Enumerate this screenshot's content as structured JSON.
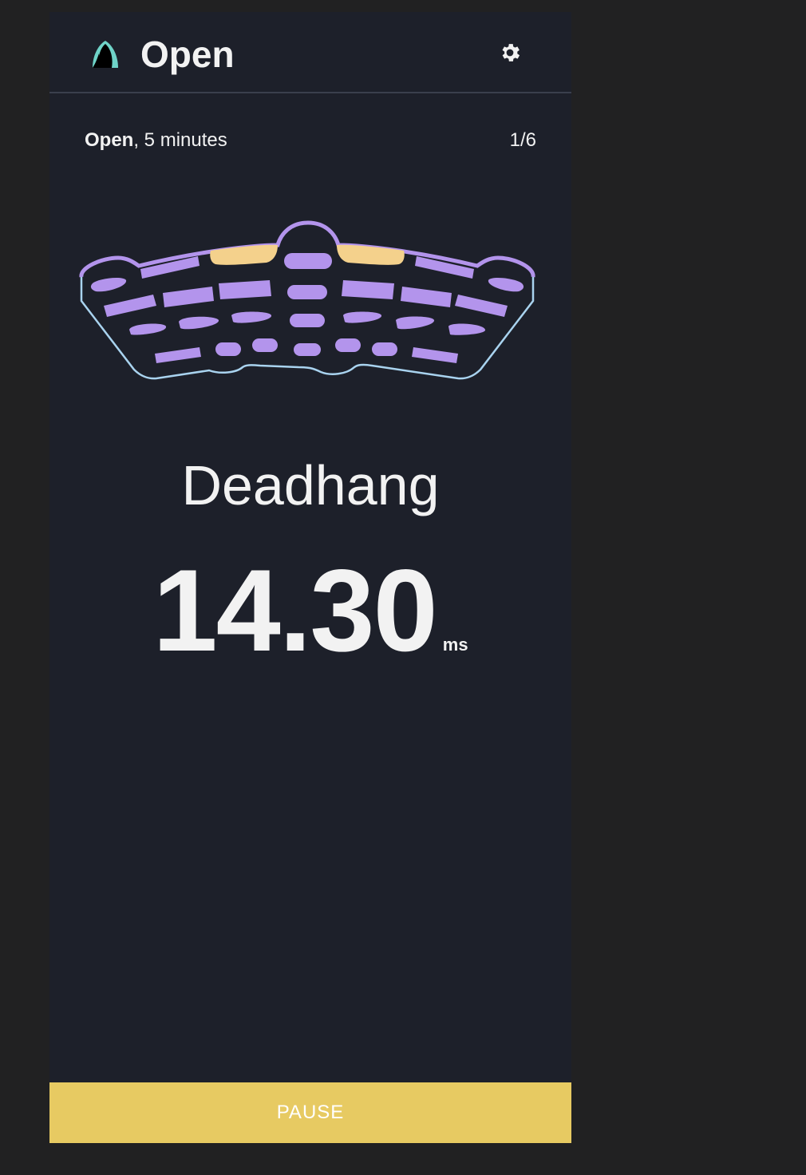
{
  "header": {
    "title": "Open",
    "logo_icon": "climber-logo-icon",
    "settings_icon": "gear-icon"
  },
  "workout": {
    "name": "Open",
    "duration_text": ", 5 minutes",
    "step_counter": "1/6"
  },
  "hangboard": {
    "active_hold_color": "#f4d18c",
    "inactive_hold_color": "#b394ec",
    "outline_color": "#a9d3ef",
    "active_holds": [
      "top-left-jug",
      "top-right-jug"
    ]
  },
  "exercise": {
    "name": "Deadhang"
  },
  "timer": {
    "value": "14.30",
    "unit": "ms"
  },
  "actions": {
    "pause_label": "PAUSE"
  },
  "colors": {
    "background": "#1d202a",
    "accent": "#e7ca62"
  }
}
